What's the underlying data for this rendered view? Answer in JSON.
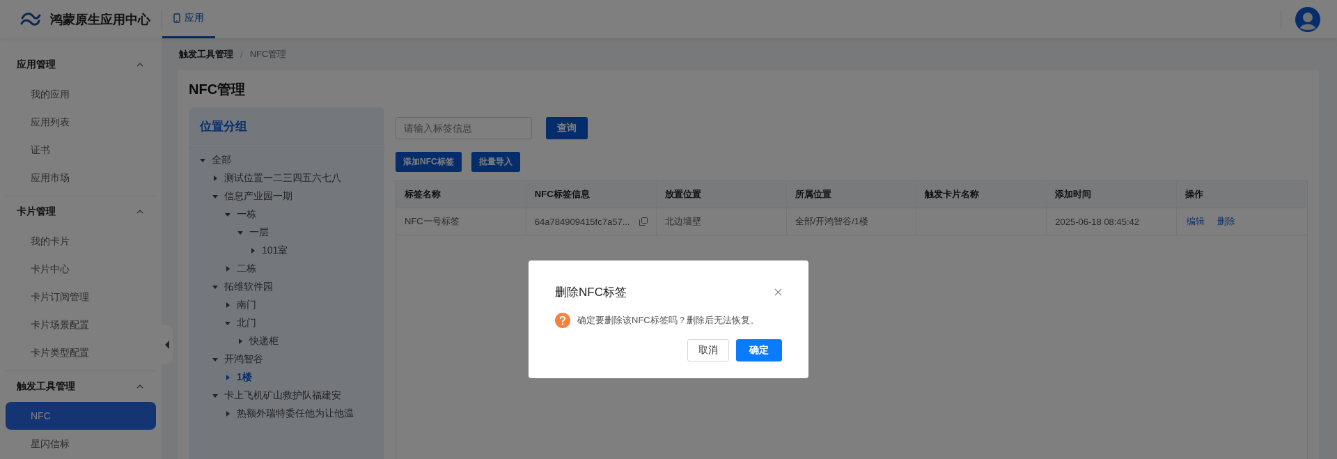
{
  "header": {
    "title": "鸿蒙原生应用中心",
    "tabs": [
      {
        "label": "应用",
        "selected": true
      }
    ]
  },
  "sidebar": {
    "groups": [
      {
        "title": "应用管理",
        "expanded": true,
        "items": [
          {
            "label": "我的应用",
            "selected": false
          },
          {
            "label": "应用列表",
            "selected": false
          },
          {
            "label": "证书",
            "selected": false
          },
          {
            "label": "应用市场",
            "selected": false
          }
        ]
      },
      {
        "title": "卡片管理",
        "expanded": true,
        "items": [
          {
            "label": "我的卡片",
            "selected": false
          },
          {
            "label": "卡片中心",
            "selected": false
          },
          {
            "label": "卡片订阅管理",
            "selected": false
          },
          {
            "label": "卡片场景配置",
            "selected": false
          },
          {
            "label": "卡片类型配置",
            "selected": false
          }
        ]
      },
      {
        "title": "触发工具管理",
        "expanded": true,
        "items": [
          {
            "label": "NFC",
            "selected": true
          },
          {
            "label": "星闪信标",
            "selected": false
          }
        ]
      }
    ]
  },
  "breadcrumb": {
    "items": [
      "触发工具管理",
      "NFC管理"
    ],
    "separator": "/"
  },
  "page_title": "NFC管理",
  "tree": {
    "title": "位置分组",
    "nodes": [
      {
        "label": "全部",
        "expanded": true,
        "selected": false,
        "children": [
          {
            "label": "测试位置一二三四五六七八",
            "expanded": false,
            "selected": false
          },
          {
            "label": "信息产业园一期",
            "expanded": true,
            "selected": false,
            "children": [
              {
                "label": "一栋",
                "expanded": true,
                "selected": false,
                "children": [
                  {
                    "label": "一层",
                    "expanded": true,
                    "selected": false,
                    "children": [
                      {
                        "label": "101室",
                        "expanded": false,
                        "selected": false
                      }
                    ]
                  }
                ]
              },
              {
                "label": "二栋",
                "expanded": false,
                "selected": false
              }
            ]
          },
          {
            "label": "拓维软件园",
            "expanded": true,
            "selected": false,
            "children": [
              {
                "label": "南门",
                "expanded": false,
                "selected": false
              },
              {
                "label": "北门",
                "expanded": true,
                "selected": false,
                "children": [
                  {
                    "label": "快递柜",
                    "expanded": false,
                    "selected": false
                  }
                ]
              }
            ]
          },
          {
            "label": "开鸿智谷",
            "expanded": true,
            "selected": false,
            "children": [
              {
                "label": "1楼",
                "expanded": false,
                "selected": true
              }
            ]
          },
          {
            "label": "卡上飞机矿山救护队福建安",
            "expanded": true,
            "selected": false,
            "children": [
              {
                "label": "热额外瑞特委任他为让他温",
                "expanded": false,
                "selected": false
              }
            ]
          }
        ]
      }
    ]
  },
  "search": {
    "placeholder": "请输入标签信息",
    "button": "查询"
  },
  "actions": [
    "添加NFC标签",
    "批量导入"
  ],
  "table": {
    "columns": [
      "标签名称",
      "NFC标签信息",
      "放置位置",
      "所属位置",
      "触发卡片名称",
      "添加时间",
      "操作"
    ],
    "rows": [
      {
        "cells": [
          "NFC一号标签",
          "64a784909415fc7a57...",
          "北边墙壁",
          "全部/开鸿智谷/1楼",
          "",
          "2025-06-18 08:45:42"
        ],
        "links": [
          "编辑",
          "删除"
        ]
      }
    ]
  },
  "dialog": {
    "title": "删除NFC标签",
    "message": "确定要删除该NFC标签吗？删除后无法恢复。",
    "buttons": [
      {
        "label": "取消",
        "kind": "default"
      },
      {
        "label": "确定",
        "kind": "primary"
      }
    ]
  }
}
